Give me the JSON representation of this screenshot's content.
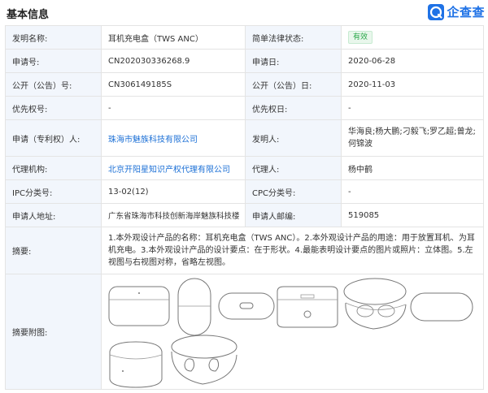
{
  "header": {
    "section_title": "基本信息",
    "brand_name": "企查查",
    "brand_color": "#1f72e6"
  },
  "fields": {
    "invention_name": {
      "label": "发明名称:",
      "value": "耳机充电盒（TWS ANC）"
    },
    "legal_status": {
      "label": "简单法律状态:",
      "value": "有效"
    },
    "application_no": {
      "label": "申请号:",
      "value": "CN202030336268.9"
    },
    "application_date": {
      "label": "申请日:",
      "value": "2020-06-28"
    },
    "publication_no": {
      "label": "公开（公告）号:",
      "value": "CN306149185S"
    },
    "publication_date": {
      "label": "公开（公告）日:",
      "value": "2020-11-03"
    },
    "priority_no": {
      "label": "优先权号:",
      "value": "-"
    },
    "priority_date": {
      "label": "优先权日:",
      "value": "-"
    },
    "applicant": {
      "label": "申请（专利权）人:",
      "value": "珠海市魅族科技有限公司"
    },
    "inventors": {
      "label": "发明人:",
      "value": "华海良;杨大鹏;刁毅飞;罗乙超;曾龙;何锦波"
    },
    "agency": {
      "label": "代理机构:",
      "value": "北京开阳星知识产权代理有限公司"
    },
    "agent": {
      "label": "代理人:",
      "value": "杨中鹤"
    },
    "ipc": {
      "label": "IPC分类号:",
      "value": "13-02(12)"
    },
    "cpc": {
      "label": "CPC分类号:",
      "value": "-"
    },
    "address": {
      "label": "申请人地址:",
      "value": "广东省珠海市科技创新海岸魅族科技楼"
    },
    "postal_code": {
      "label": "申请人邮编:",
      "value": "519085"
    },
    "abstract": {
      "label": "摘要:",
      "value": "1.本外观设计产品的名称：耳机充电盒（TWS ANC）。2.本外观设计产品的用途：用于放置耳机、为耳机充电。3.本外观设计产品的设计要点：在于形状。4.最能表明设计要点的图片或照片：立体图。5.左视图与右视图对称，省略左视图。"
    },
    "abstract_figures": {
      "label": "摘要附图:"
    }
  },
  "colors": {
    "label_bg": "#f2f6fc",
    "border": "#e4e4e4",
    "link": "#1c70d6",
    "status_green": "#2aa84a"
  }
}
